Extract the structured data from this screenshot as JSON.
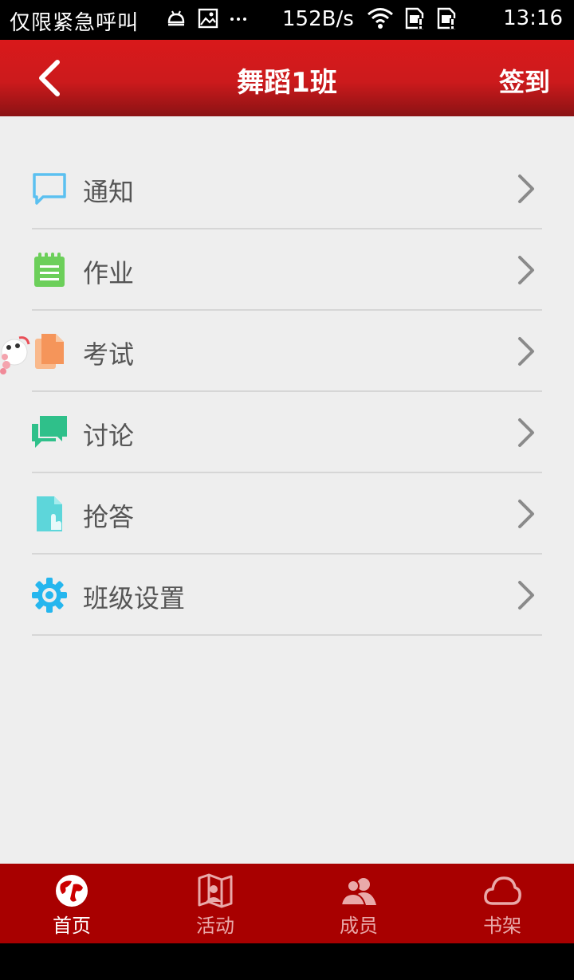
{
  "status_bar": {
    "carrier": "仅限紧急呼叫",
    "speed": "152B/s",
    "time": "13:16",
    "icons": [
      "android-debug-icon",
      "image-icon",
      "more-icon",
      "wifi-icon",
      "sim-alert-icon",
      "sim-alert-icon"
    ]
  },
  "header": {
    "back_icon": "chevron-left-icon",
    "title": "舞蹈1班",
    "action": "签到"
  },
  "menu": {
    "items": [
      {
        "label": "通知",
        "icon": "chat-bubble-icon",
        "color": "#5bc0f0"
      },
      {
        "label": "作业",
        "icon": "notepad-icon",
        "color": "#6ccf5a"
      },
      {
        "label": "考试",
        "icon": "document-icon",
        "color": "#f5955a"
      },
      {
        "label": "讨论",
        "icon": "discussion-icon",
        "color": "#2fc08a"
      },
      {
        "label": "抢答",
        "icon": "hand-tap-icon",
        "color": "#5dd6da"
      },
      {
        "label": "班级设置",
        "icon": "gear-icon",
        "color": "#25b6ee"
      }
    ]
  },
  "bottom_nav": {
    "items": [
      {
        "label": "首页",
        "icon": "globe-icon",
        "active": true
      },
      {
        "label": "活动",
        "icon": "map-icon",
        "active": false
      },
      {
        "label": "成员",
        "icon": "members-icon",
        "active": false
      },
      {
        "label": "书架",
        "icon": "cloud-icon",
        "active": false
      }
    ]
  },
  "colors": {
    "header_red": "#cc1a1c",
    "nav_red": "#a80000",
    "background": "#eeeeee"
  }
}
